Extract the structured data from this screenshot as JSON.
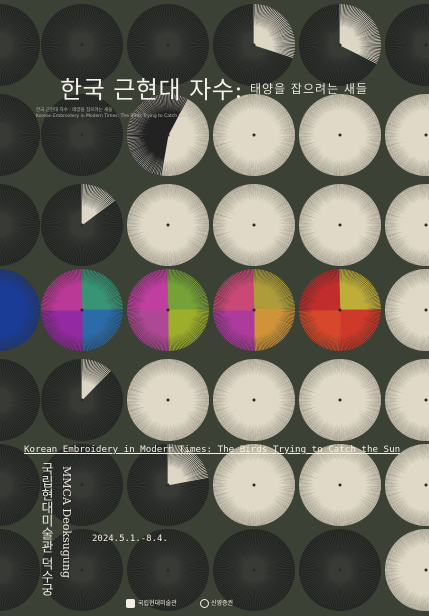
{
  "poster": {
    "title_ko": "한국 근현대 자수:",
    "subtitle_ko": "태양을 잡으려는 새들",
    "info_lines": [
      "한국 근현대 자수 : 태양을 잡으려는 새들",
      "Korean Embroidery in Modern Times: The Birds Trying to Catch the Sun"
    ],
    "title_en": "Korean Embroidery in Modern Times: The Birds Trying to Catch the Sun",
    "venue_ko": "국립현대미술관 덕수궁",
    "venue_en": "MMCA Deoksugung",
    "dates": "2024.5.1.-8.4.",
    "logos": [
      "국립현대미술관",
      "신영증권"
    ],
    "colors": {
      "background": "#3c4136",
      "thread": "#e8e2d2",
      "thread_dark": "#1c1d19",
      "text": "#f3efe4"
    }
  }
}
